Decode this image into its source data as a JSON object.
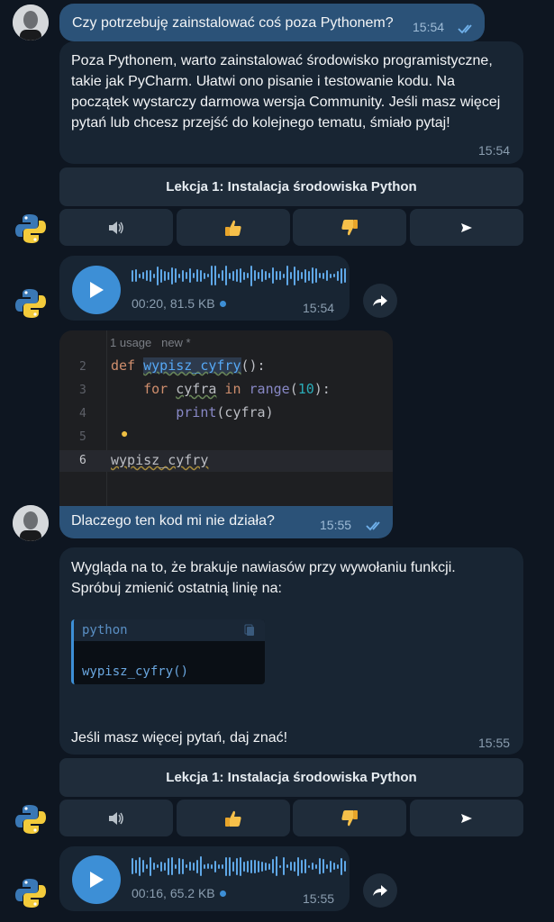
{
  "messages": {
    "m1": {
      "text": "Czy potrzebuję zainstalować coś poza Pythonem?",
      "time": "15:54"
    },
    "m2": {
      "text": "Poza Pythonem, warto zainstalować środowisko programistyczne, takie jak PyCharm. Ułatwi ono pisanie i testowanie kodu. Na początek wystarczy darmowa wersja Community. Jeśli masz więcej pytań lub chcesz przejść do kolejnego tematu, śmiało pytaj!",
      "time": "15:54"
    },
    "voice1": {
      "meta": "00:20, 81.5 KB",
      "time": "15:54",
      "progress": 0
    },
    "code_image": {
      "hint": "1 usage   new *",
      "lines": [
        {
          "no": "2",
          "text": "def wypisz_cyfry():"
        },
        {
          "no": "3",
          "text": "    for cyfra in range(10):"
        },
        {
          "no": "4",
          "text": "        print(cyfra)"
        },
        {
          "no": "5",
          "text": ""
        },
        {
          "no": "6",
          "text": "wypisz_cyfry"
        }
      ]
    },
    "m3": {
      "text": "Dlaczego ten kod mi nie działa?",
      "time": "15:55"
    },
    "m4": {
      "text1": "Wygląda na to, że brakuje nawiasów przy wywołaniu funkcji. Spróbuj zmienić ostatnią linię na:",
      "code_lang": "python",
      "code": "wypisz_cyfry()",
      "text2": "Jeśli masz więcej pytań, daj znać!",
      "time": "15:55"
    },
    "voice2": {
      "meta": "00:16, 65.2 KB",
      "time": "15:55",
      "progress": 0
    }
  },
  "keyboard": {
    "lesson_label": "Lekcja 1: Instalacja środowiska Python",
    "icons": [
      "speaker-icon",
      "thumbs-up-icon",
      "thumbs-down-icon",
      "send-icon"
    ]
  },
  "colors": {
    "background": "#0e1621",
    "outgoing": "#2b5278",
    "incoming": "#182533",
    "accent": "#3d8fd6"
  }
}
